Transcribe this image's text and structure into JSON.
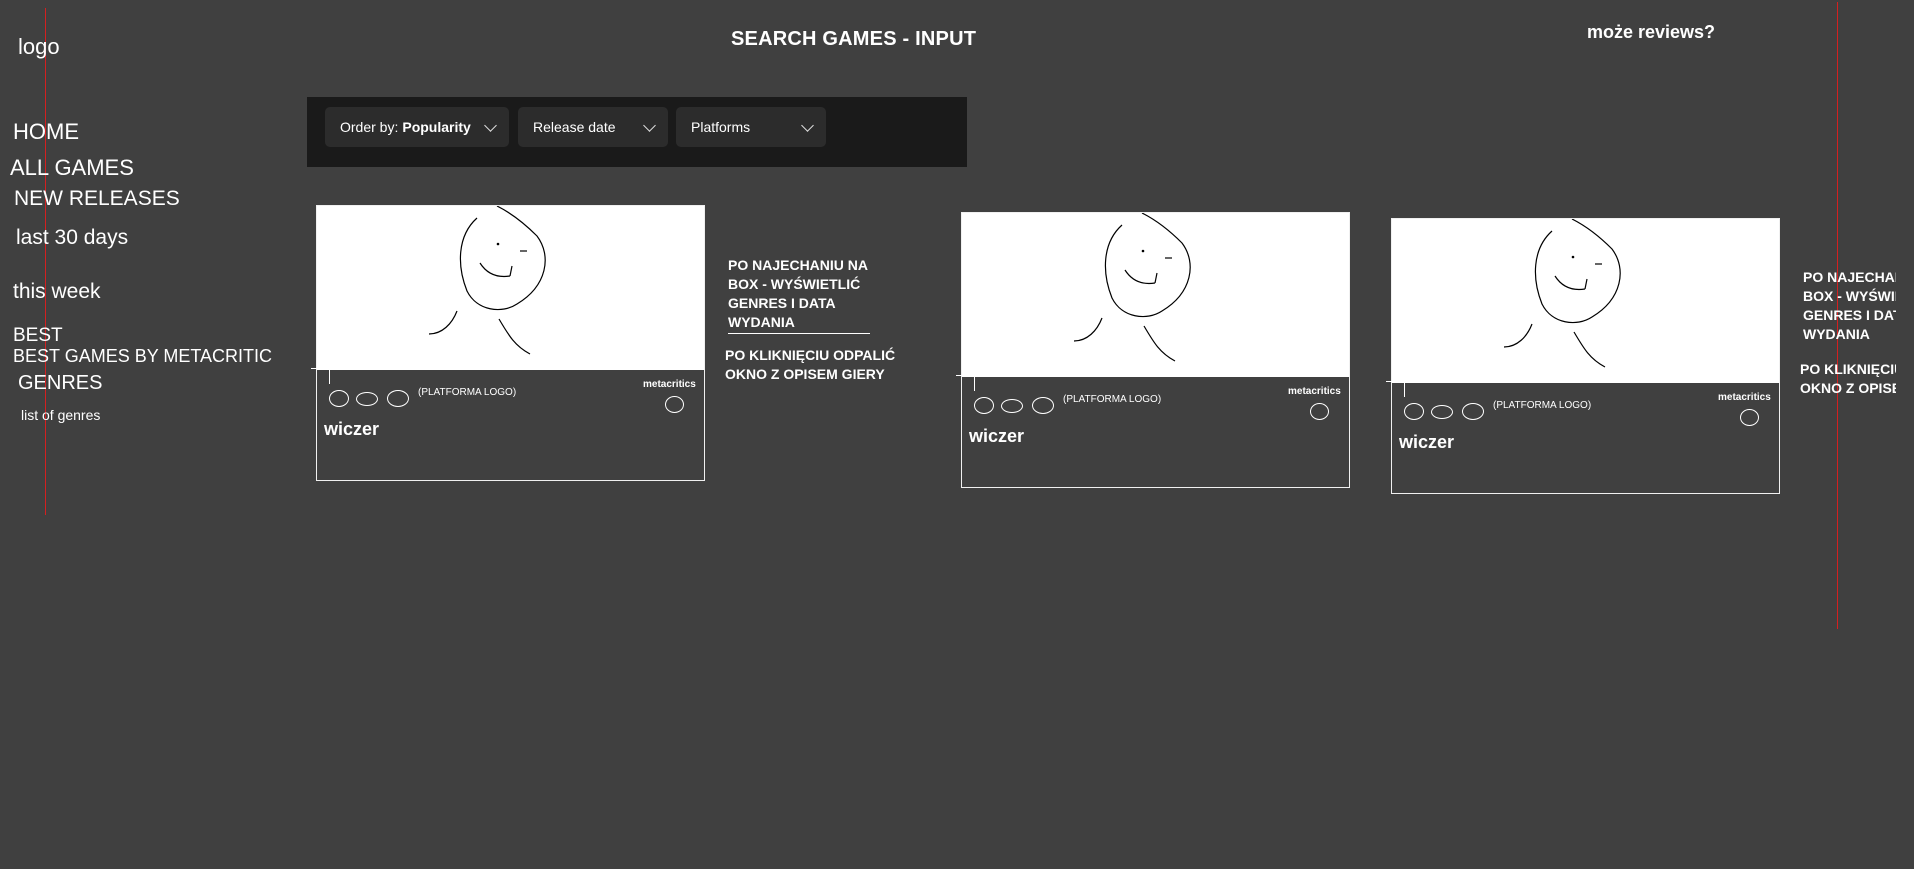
{
  "sidebar": {
    "logo": "logo",
    "items": [
      {
        "label": "HOME"
      },
      {
        "label": "ALL GAMES"
      },
      {
        "label": "NEW RELEASES"
      },
      {
        "label": "last 30 days"
      },
      {
        "label": "this week"
      },
      {
        "label": "BEST"
      },
      {
        "label": "BEST GAMES BY METACRITIC"
      },
      {
        "label": "GENRES"
      },
      {
        "label": "list of genres"
      }
    ]
  },
  "header": {
    "title": "SEARCH GAMES - INPUT",
    "reviews_note": "może reviews?"
  },
  "filters": {
    "order_prefix": "Order by:",
    "order_value": "Popularity",
    "release": "Release date",
    "platforms": "Platforms"
  },
  "cards": [
    {
      "platform_label": "(PLATFORMA LOGO)",
      "metacritic_label": "metacritics",
      "title": "wiczer"
    },
    {
      "platform_label": "(PLATFORMA LOGO)",
      "metacritic_label": "metacritics",
      "title": "wiczer"
    },
    {
      "platform_label": "(PLATFORMA LOGO)",
      "metacritic_label": "metacritics",
      "title": "wiczer"
    }
  ],
  "notes": {
    "hover": [
      "PO NAJECHANIU NA",
      "BOX - WYŚWIETLIĆ",
      "GENRES I DATA",
      "WYDANIA"
    ],
    "click": [
      "PO KLIKNIĘCIU ODPALIĆ",
      "OKNO Z OPISEM GIERY"
    ]
  },
  "colors": {
    "background": "#404040",
    "filter_bar": "#1a1a1a",
    "filter_button": "#2c2c2c",
    "guide_line": "#d42020"
  }
}
